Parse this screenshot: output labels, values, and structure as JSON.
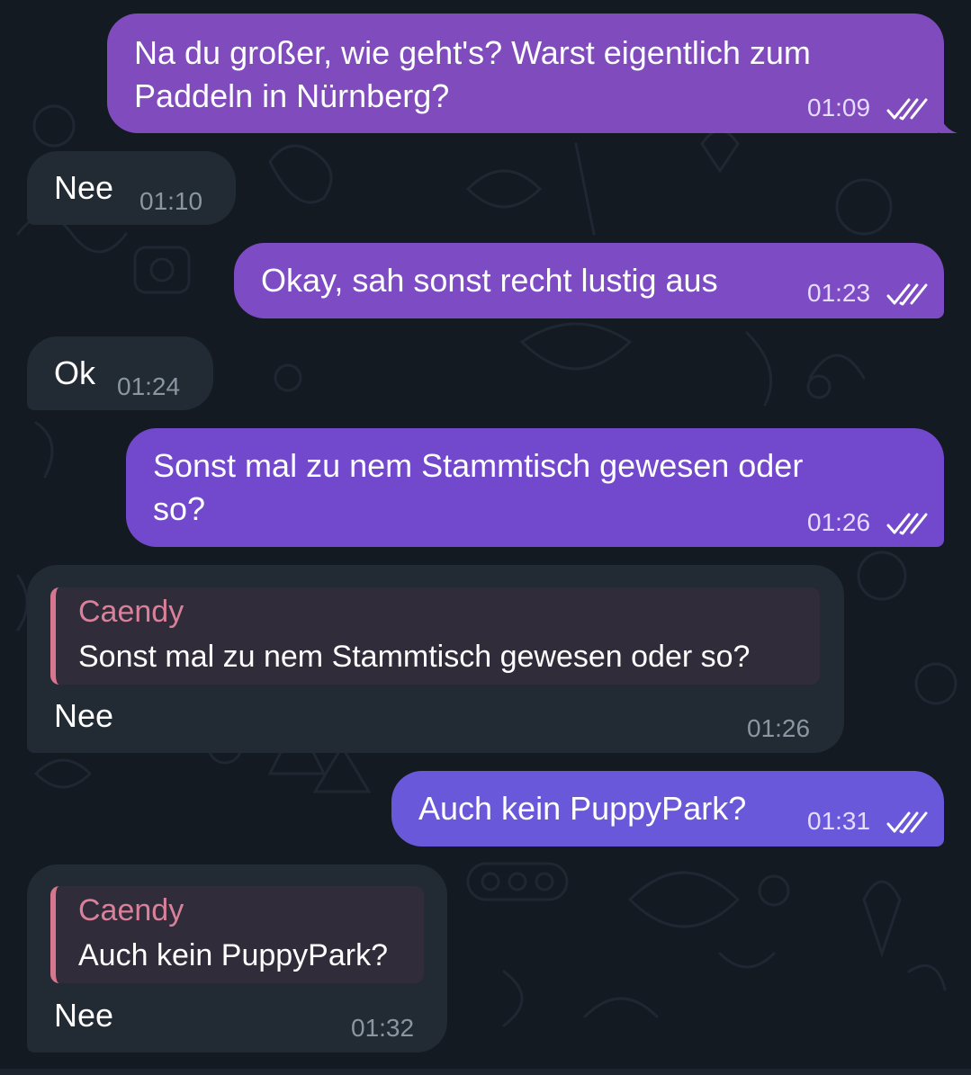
{
  "colors": {
    "background": "#141a22",
    "outgoing_bubble": "#7f4bbd",
    "incoming_bubble": "#222a34",
    "reply_accent": "#d7768f"
  },
  "messages": [
    {
      "direction": "out",
      "lines": [
        "Na du großer, wie geht's? Warst eigentlich zum",
        "Paddeln in Nürnberg?"
      ],
      "time": "01:09",
      "status": "read-ticks-icon"
    },
    {
      "direction": "in",
      "text": "Nee",
      "time": "01:10"
    },
    {
      "direction": "out",
      "text": "Okay, sah sonst recht lustig aus",
      "time": "01:23",
      "status": "read-ticks-icon"
    },
    {
      "direction": "in",
      "text": "Ok",
      "time": "01:24"
    },
    {
      "direction": "out",
      "lines": [
        "Sonst mal zu nem Stammtisch gewesen oder",
        "so?"
      ],
      "time": "01:26",
      "status": "read-ticks-icon"
    },
    {
      "direction": "in",
      "reply": {
        "name": "Caendy",
        "text": "Sonst mal zu nem Stammtisch gewesen oder so?"
      },
      "text": "Nee",
      "time": "01:26"
    },
    {
      "direction": "out",
      "text": "Auch kein PuppyPark?",
      "time": "01:31",
      "status": "read-ticks-icon"
    },
    {
      "direction": "in",
      "reply": {
        "name": "Caendy",
        "text": "Auch kein PuppyPark?"
      },
      "text": "Nee",
      "time": "01:32"
    }
  ]
}
